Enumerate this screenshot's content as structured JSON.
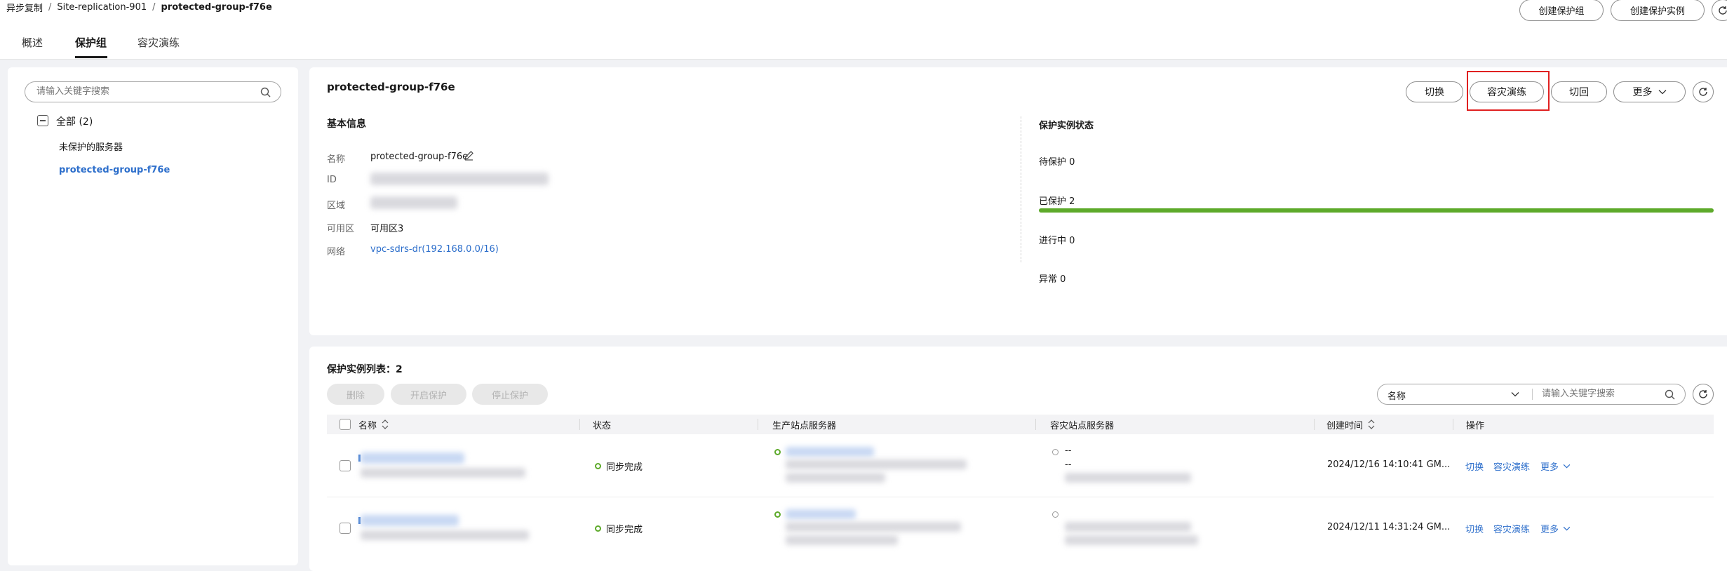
{
  "breadcrumb": [
    "异步复制",
    "Site-replication-901",
    "protected-group-f76e"
  ],
  "breadcrumb_sep": "/",
  "header_buttons": {
    "create_group": "创建保护组",
    "create_instance": "创建保护实例"
  },
  "tabs": [
    "概述",
    "保护组",
    "容灾演练"
  ],
  "active_tab": 1,
  "sidebar": {
    "search_placeholder": "请输入关键字搜索",
    "tree_root": "全部 (2)",
    "tree_items": [
      "未保护的服务器",
      "protected-group-f76e"
    ]
  },
  "group": {
    "title": "protected-group-f76e",
    "actions": {
      "switch": "切换",
      "drill": "容灾演练",
      "failback": "切回",
      "more": "更多"
    },
    "basic_info_title": "基本信息",
    "fields": {
      "name_label": "名称",
      "name_value": "protected-group-f76e",
      "id_label": "ID",
      "region_label": "区域",
      "az_label": "可用区",
      "az_value": "可用区3",
      "network_label": "网络",
      "network_value": "vpc-sdrs-dr(192.168.0.0/16)"
    },
    "status_title": "保护实例状态",
    "status": [
      {
        "label": "待保护 0",
        "fill": 0
      },
      {
        "label": "已保护 2",
        "fill": 1
      },
      {
        "label": "进行中 0",
        "fill": 0
      },
      {
        "label": "异常 0",
        "fill": 0
      }
    ],
    "accent_color": "#5daa2a"
  },
  "instances": {
    "title": "保护实例列表：2",
    "buttons": {
      "delete": "删除",
      "start": "开启保护",
      "stop": "停止保护"
    },
    "filter_select": "名称",
    "search_placeholder": "请输入关键字搜索",
    "columns": [
      "名称",
      "状态",
      "生产站点服务器",
      "容灾站点服务器",
      "创建时间",
      "操作"
    ],
    "rows": [
      {
        "status": "同步完成",
        "dr_text1": "--",
        "dr_text2": "--",
        "created": "2024/12/16 14:10:41 GM...",
        "ops": [
          "切换",
          "容灾演练",
          "更多"
        ]
      },
      {
        "status": "同步完成",
        "created": "2024/12/11 14:31:24 GM...",
        "ops": [
          "切换",
          "容灾演练",
          "更多"
        ]
      }
    ]
  }
}
